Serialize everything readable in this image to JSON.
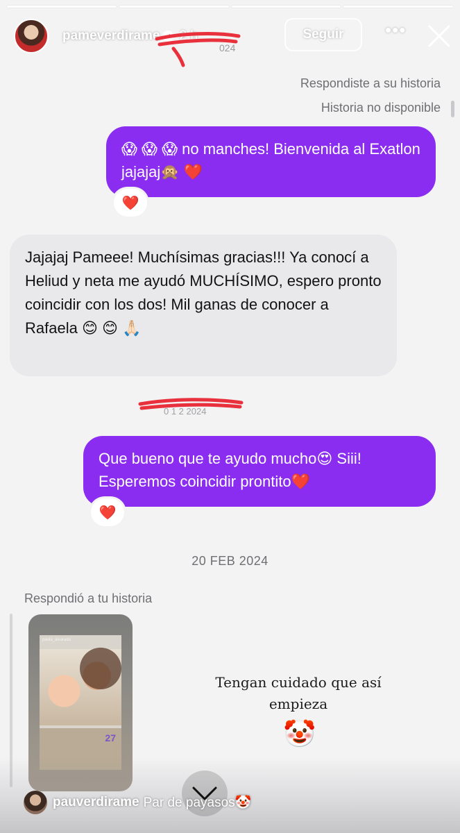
{
  "story": {
    "username": "pameverdirame",
    "time": "2 h",
    "follow_label": "Seguir",
    "progress_segments": 4
  },
  "conversation": {
    "meta_replied": "Respondiste a su historia",
    "meta_unavailable": "Historia no disponible",
    "messages": [
      {
        "side": "sent",
        "text": "😱 😱 😱  no manches! Bienvenida al Exatlon jajajaj🙊 ❤️",
        "reaction": "❤️"
      },
      {
        "side": "received",
        "text": "Jajajaj Pameee! Muchísimas gracias!!! Ya conocí a Heliud y neta me ayudó MUCHÍSIMO, espero pronto coincidir con los dos! Mil ganas de conocer a Rafaela 😊 😊 🙏🏻"
      },
      {
        "side": "sent",
        "text": "Que bueno que te ayudo mucho😍  Siii! Esperemos coincidir prontito❤️",
        "reaction": "❤️"
      }
    ],
    "date_separator": "20 FEB 2024",
    "replied_to_story_label": "Respondió a tu historia",
    "story_reply": {
      "thumb_tag": "paola_alvarado",
      "thumb_number": "27",
      "text": "Tengan cuidado que así empieza",
      "emoji": "🤡"
    }
  },
  "footer": {
    "comment_user": "pauverdirame",
    "comment_text": "Par de payasos🤡"
  },
  "icons": {
    "verified": "verified-badge-icon",
    "more": "more-horizontal-icon",
    "close": "close-icon",
    "chevron": "chevron-down-icon"
  },
  "colors": {
    "sent_bubble": "#8a2df0",
    "received_bubble": "#e9e9eb",
    "background": "#f3f3f4",
    "redaction": "#e8313c"
  }
}
